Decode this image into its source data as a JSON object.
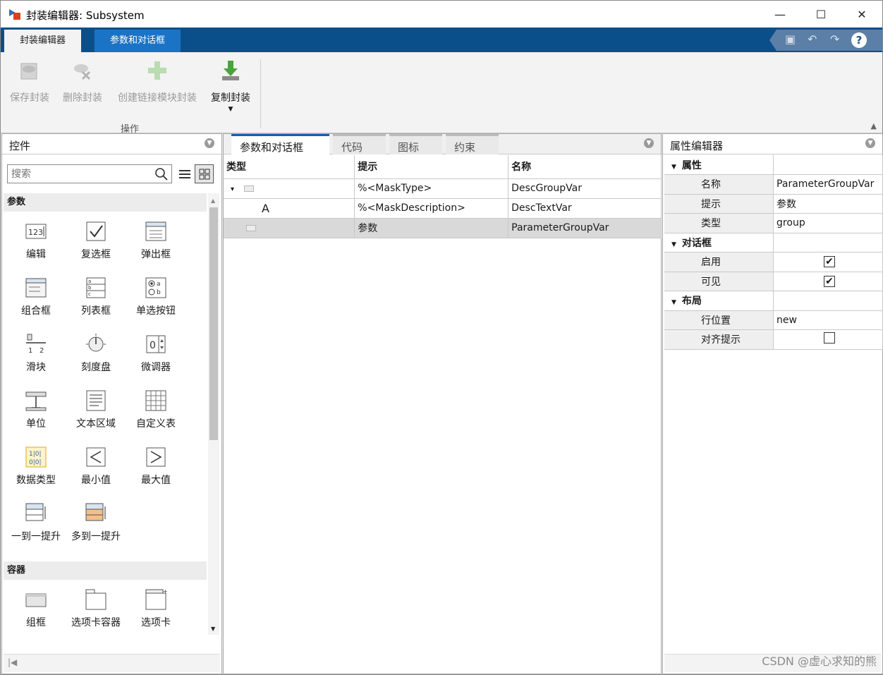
{
  "window": {
    "title": "封装编辑器: Subsystem",
    "minimize": "—",
    "maximize": "☐",
    "close": "✕"
  },
  "ribbon_tabs": {
    "active": "封装编辑器",
    "second": "参数和对话框"
  },
  "ribbon": {
    "buttons": {
      "save": "保存封装",
      "delete": "删除封装",
      "create_link": "创建链接模块封装",
      "copy": "复制封装"
    },
    "group_label": "操作"
  },
  "left_pane": {
    "title": "控件",
    "search_placeholder": "搜索",
    "sections": {
      "params": "参数",
      "containers": "容器"
    },
    "controls": [
      {
        "label": "编辑",
        "icon": "edit-icon"
      },
      {
        "label": "复选框",
        "icon": "checkbox-icon"
      },
      {
        "label": "弹出框",
        "icon": "popup-icon"
      },
      {
        "label": "组合框",
        "icon": "combobox-icon"
      },
      {
        "label": "列表框",
        "icon": "listbox-icon"
      },
      {
        "label": "单选按钮",
        "icon": "radio-button-icon"
      },
      {
        "label": "滑块",
        "icon": "slider-icon"
      },
      {
        "label": "刻度盘",
        "icon": "dial-icon"
      },
      {
        "label": "微调器",
        "icon": "spinner-icon"
      },
      {
        "label": "单位",
        "icon": "unit-icon"
      },
      {
        "label": "文本区域",
        "icon": "text-area-icon"
      },
      {
        "label": "自定义表",
        "icon": "custom-table-icon"
      },
      {
        "label": "数据类型",
        "icon": "data-type-icon"
      },
      {
        "label": "最小值",
        "icon": "min-value-icon"
      },
      {
        "label": "最大值",
        "icon": "max-value-icon"
      },
      {
        "label": "一到一提升",
        "icon": "promote-one-icon"
      },
      {
        "label": "多到一提升",
        "icon": "promote-many-icon"
      }
    ],
    "containers": [
      {
        "label": "组框",
        "icon": "group-box-icon"
      },
      {
        "label": "选项卡容器",
        "icon": "tab-container-icon"
      },
      {
        "label": "选项卡",
        "icon": "tab-icon"
      }
    ]
  },
  "center_pane": {
    "tabs": [
      "参数和对话框",
      "代码",
      "图标",
      "约束"
    ],
    "columns": [
      "类型",
      "提示",
      "名称"
    ],
    "rows": [
      {
        "type_glyph": "▾",
        "prompt": "%<MaskType>",
        "name": "DescGroupVar"
      },
      {
        "type_glyph": "A",
        "prompt": "%<MaskDescription>",
        "name": "DescTextVar"
      },
      {
        "type_glyph": "",
        "prompt": "参数",
        "name": "ParameterGroupVar"
      }
    ]
  },
  "right_pane": {
    "title": "属性编辑器",
    "categories": {
      "properties": "属性",
      "dialog": "对话框",
      "layout": "布局"
    },
    "props": {
      "name_key": "名称",
      "name_val": "ParameterGroupVar",
      "prompt_key": "提示",
      "prompt_val": "参数",
      "type_key": "类型",
      "type_val": "group",
      "enable_key": "启用",
      "visible_key": "可见",
      "row_key": "行位置",
      "row_val": "new",
      "align_key": "对齐提示"
    },
    "checks": {
      "enable": true,
      "visible": true,
      "align": false
    }
  },
  "watermark": "CSDN @虚心求知的熊",
  "colors": {
    "ribbon_bar": "#0b4f8a",
    "active_tab": "#1b73c6"
  }
}
